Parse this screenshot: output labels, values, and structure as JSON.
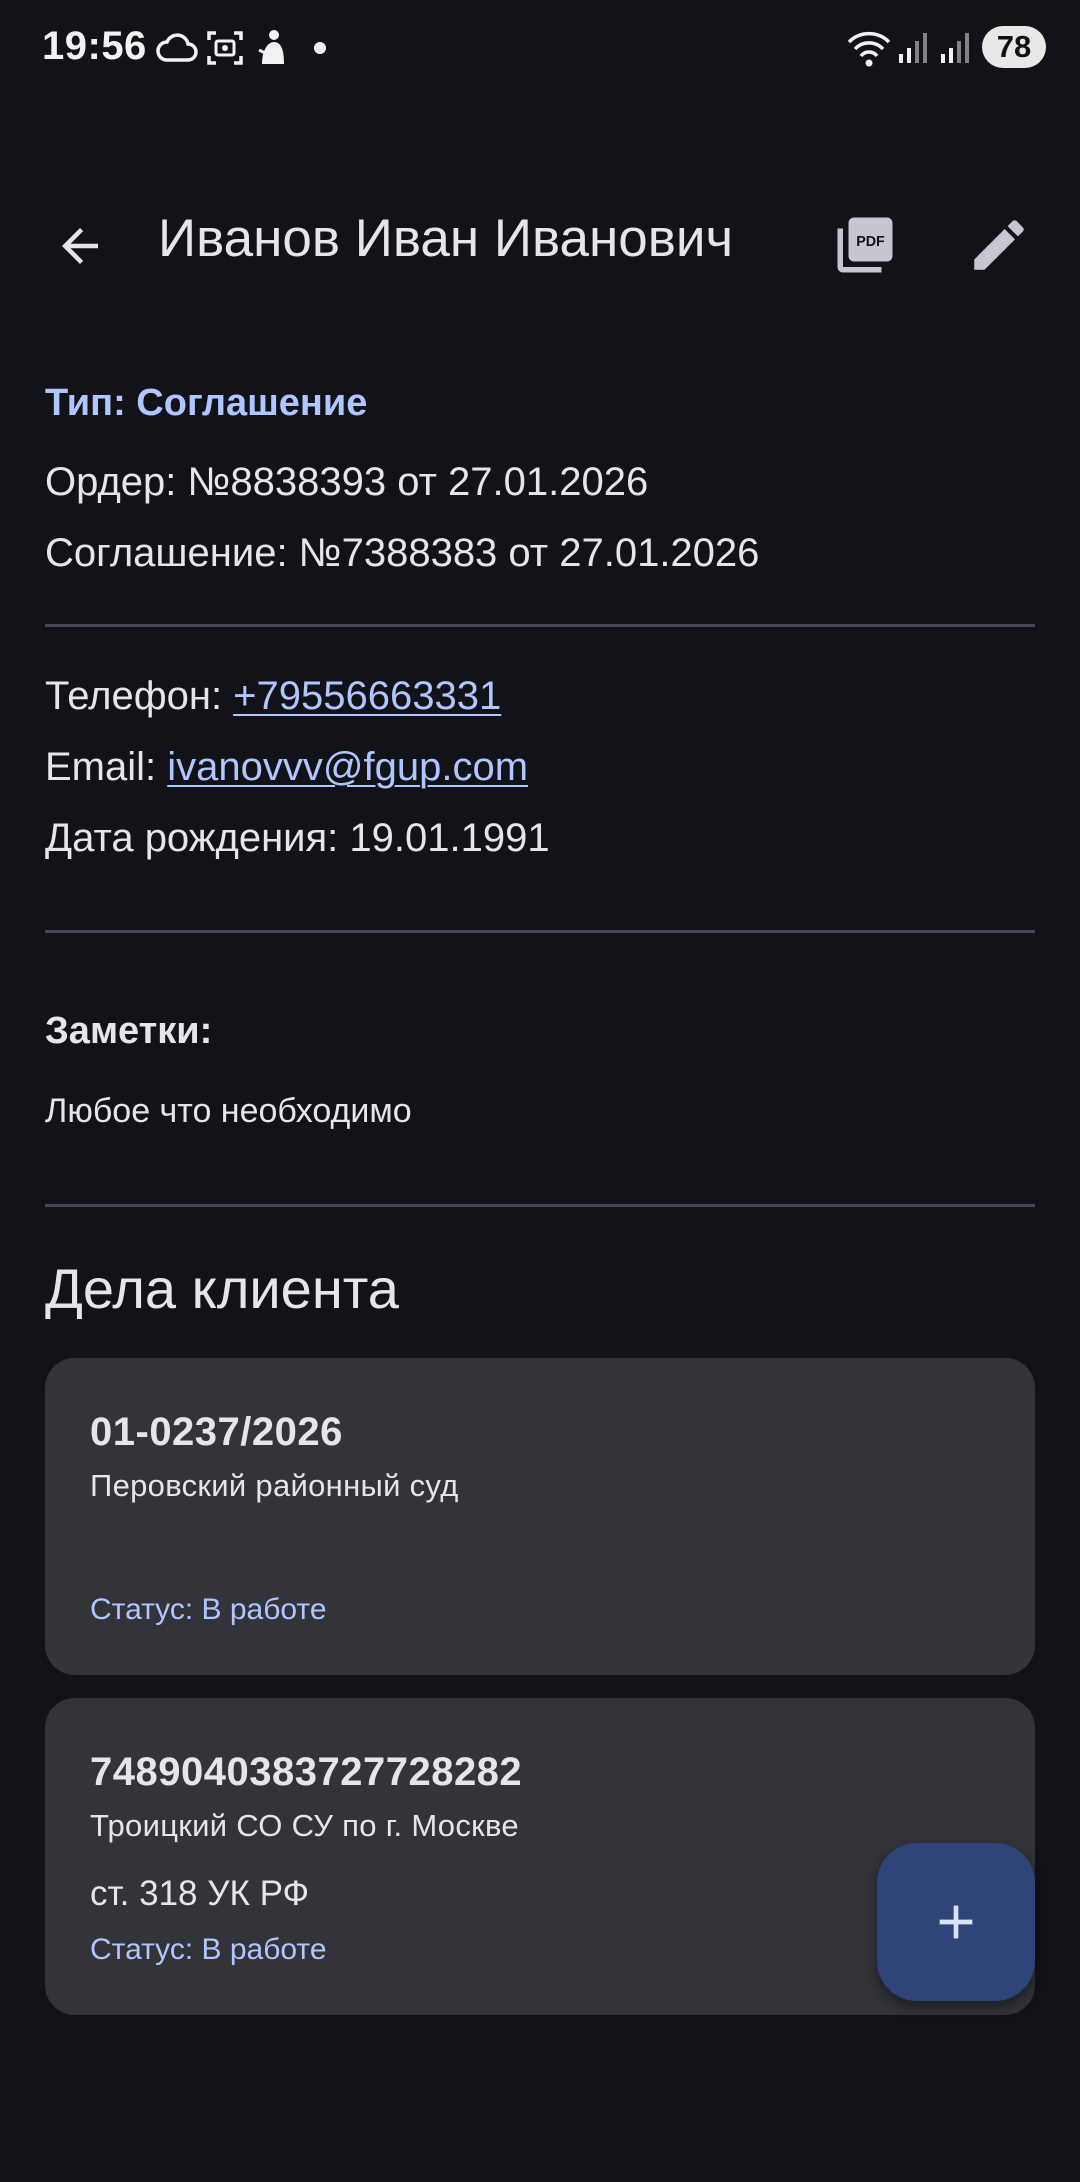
{
  "status_bar": {
    "time": "19:56",
    "battery": "78",
    "icons": [
      "cloud-icon",
      "screenshot-icon",
      "app-notification-icon",
      "wifi-icon",
      "signal-icon",
      "signal-icon"
    ]
  },
  "app_bar": {
    "title": "Иванов Иван Иванович",
    "back_icon": "arrow-back-icon",
    "pdf_icon": "pdf-icon",
    "edit_icon": "pencil-icon"
  },
  "client": {
    "type": "Тип: Соглашение",
    "order": "Ордер: №8838393 от 27.01.2026",
    "agreement": "Соглашение: №7388383 от 27.01.2026",
    "phone_label": "Телефон: ",
    "phone": "+79556663331",
    "email_label": "Email: ",
    "email": "ivanovvv@fgup.com",
    "birth_date": "Дата рождения: 19.01.1991"
  },
  "notes": {
    "label": "Заметки:",
    "text": "Любое что необходимо"
  },
  "cases": {
    "title": "Дела клиента",
    "items": [
      {
        "number": "01-0237/2026",
        "court": "Перовский районный суд",
        "article": "",
        "status": "Статус: В работе"
      },
      {
        "number": "7489040383727728282",
        "court": "Троицкий СО СУ по г. Москве",
        "article": "ст. 318 УК РФ",
        "status": "Статус: В работе"
      }
    ]
  },
  "fab": {
    "icon": "plus-icon"
  },
  "colors": {
    "background": "#121318",
    "card": "#33343a",
    "accent": "#b0c6ff",
    "fab": "#2f4478"
  }
}
